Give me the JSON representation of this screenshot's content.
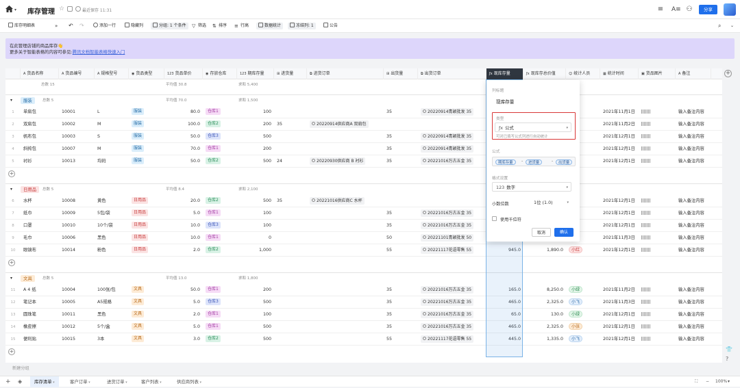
{
  "app": {
    "title": "库存管理",
    "saved": "最近保存 11:31",
    "share": "分享"
  },
  "toolbar": {
    "table_name": "库存明细表",
    "add_row": "添加一行",
    "hide_cols": "隐藏列",
    "group": "分组: 1 个条件",
    "filter": "筛选",
    "sort": "排序",
    "row_height": "行高",
    "stats": "数据统计",
    "freeze": "冻结列: 1",
    "notice": "公告"
  },
  "banner": {
    "line1": "在此管理店铺的商品库存👋",
    "line2_prefix": "更多关于智能表格的内容可参见:",
    "line2_link": "腾讯文档智能表格快速入门"
  },
  "columns": [
    {
      "label": "货品名称",
      "icon": "text-icon"
    },
    {
      "label": "货品编号",
      "icon": "text-icon"
    },
    {
      "label": "规格型号",
      "icon": "text-icon"
    },
    {
      "label": "货品类型",
      "icon": "select-icon"
    },
    {
      "label": "货品单价",
      "icon": "number-icon"
    },
    {
      "label": "存放仓库",
      "icon": "select-icon"
    },
    {
      "label": "期库存量",
      "icon": "number-icon"
    },
    {
      "label": "进货量",
      "icon": "lookup-icon"
    },
    {
      "label": "进货订单",
      "icon": "link-icon"
    },
    {
      "label": "出货量",
      "icon": "lookup-icon"
    },
    {
      "label": "出货订单",
      "icon": "link-icon"
    },
    {
      "label": "现库存量",
      "icon": "formula-icon"
    },
    {
      "label": "现库存总价值",
      "icon": "formula-icon"
    },
    {
      "label": "统计人员",
      "icon": "person-icon"
    },
    {
      "label": "统计时间",
      "icon": "date-icon"
    },
    {
      "label": "货品图片",
      "icon": "image-icon"
    },
    {
      "label": "备注",
      "icon": "text-icon"
    }
  ],
  "summary": {
    "count": "总数 15",
    "avg": "平均值 30.8",
    "sum": "求和 5,400"
  },
  "groups": [
    {
      "name": "服装",
      "tag_class": "t-fz",
      "count": "总数 5",
      "avg": "平均值 70.0",
      "sum": "求和 1,500",
      "rows": [
        {
          "n": "1",
          "name": "单肩包",
          "code": "10001",
          "spec": "L",
          "type": "服装",
          "price": "80.0",
          "wh": "仓库1",
          "whc": "w1",
          "stock": "100",
          "in": "",
          "in_order": "",
          "out": "35",
          "out_order": "20220914青颖批发 35",
          "now": "",
          "val": "",
          "person": "",
          "pc": "",
          "date": "2021年11月1日",
          "note": "输入备注内容"
        },
        {
          "n": "2",
          "name": "双肩包",
          "code": "10002",
          "spec": "M",
          "type": "服装",
          "price": "100.0",
          "wh": "仓库2",
          "whc": "w2",
          "stock": "200",
          "in": "35",
          "in_order": "20220914供应商A 双肩包",
          "out": "",
          "out_order": "",
          "now": "",
          "val": "",
          "person": "",
          "pc": "",
          "date": "2021年11月2日",
          "note": "输入备注内容"
        },
        {
          "n": "3",
          "name": "帆布包",
          "code": "10003",
          "spec": "S",
          "type": "服装",
          "price": "50.0",
          "wh": "仓库3",
          "whc": "w3",
          "stock": "500",
          "in": "",
          "in_order": "",
          "out": "35",
          "out_order": "20220914青颖批发 35",
          "now": "",
          "val": "",
          "person": "",
          "pc": "",
          "date": "2021年12月1日",
          "note": "输入备注内容"
        },
        {
          "n": "4",
          "name": "斜挎包",
          "code": "10007",
          "spec": "M",
          "type": "服装",
          "price": "70.0",
          "wh": "仓库1",
          "whc": "w1",
          "stock": "200",
          "in": "",
          "in_order": "",
          "out": "35",
          "out_order": "20220914青颖批发 35",
          "now": "",
          "val": "",
          "person": "",
          "pc": "",
          "date": "2021年12月1日",
          "note": "输入备注内容"
        },
        {
          "n": "5",
          "name": "衬衫",
          "code": "10013",
          "spec": "均码",
          "type": "服装",
          "price": "50.0",
          "wh": "仓库2",
          "whc": "w2",
          "stock": "500",
          "in": "24",
          "in_order": "20220930供应商 B 衬衫",
          "out": "35",
          "out_order": "20221016万古五金 35",
          "now": "",
          "val": "",
          "person": "",
          "pc": "",
          "date": "2021年12月1日",
          "note": "输入备注内容"
        }
      ]
    },
    {
      "name": "日用品",
      "tag_class": "t-ry",
      "count": "总数 5",
      "avg": "平均值 8.4",
      "sum": "求和 2,100",
      "rows": [
        {
          "n": "6",
          "name": "水杯",
          "code": "10008",
          "spec": "黄色",
          "type": "日用品",
          "price": "20.0",
          "wh": "仓库2",
          "whc": "w2",
          "stock": "500",
          "in": "35",
          "in_order": "20221016供应商C 水杯",
          "out": "",
          "out_order": "",
          "now": "",
          "val": "",
          "person": "",
          "pc": "",
          "date": "2021年12月1日",
          "note": "输入备注内容"
        },
        {
          "n": "7",
          "name": "纸巾",
          "code": "10009",
          "spec": "5包/袋",
          "type": "日用品",
          "price": "5.0",
          "wh": "仓库1",
          "whc": "w1",
          "stock": "100",
          "in": "",
          "in_order": "",
          "out": "35",
          "out_order": "20221016万古五金 35",
          "now": "",
          "val": "",
          "person": "",
          "pc": "",
          "date": "2021年12月1日",
          "note": "输入备注内容"
        },
        {
          "n": "8",
          "name": "口罩",
          "code": "10010",
          "spec": "10个/袋",
          "type": "日用品",
          "price": "10.0",
          "wh": "仓库3",
          "whc": "w3",
          "stock": "100",
          "in": "",
          "in_order": "",
          "out": "35",
          "out_order": "20221016万古五金 35",
          "now": "",
          "val": "",
          "person": "",
          "pc": "",
          "date": "2021年12月1日",
          "note": "输入备注内容"
        },
        {
          "n": "9",
          "name": "毛巾",
          "code": "10006",
          "spec": "黑色",
          "type": "日用品",
          "price": "10.0",
          "wh": "仓库1",
          "whc": "w1",
          "stock": "0",
          "in": "",
          "in_order": "",
          "out": "50",
          "out_order": "20221101青颖批发 50",
          "now": "",
          "val": "",
          "person": "",
          "pc": "",
          "date": "2021年11月3日",
          "note": "输入备注内容"
        },
        {
          "n": "10",
          "name": "眼镜布",
          "code": "10014",
          "spec": "粉色",
          "type": "日用品",
          "price": "2.0",
          "wh": "仓库2",
          "whc": "w2",
          "stock": "1,000",
          "in": "",
          "in_order": "",
          "out": "55",
          "out_order": "20221117花语零售 55",
          "now": "945.0",
          "val": "1,890.0",
          "person": "小红",
          "pc": "p-r",
          "date": "2021年12月1日",
          "note": "输入备注内容"
        }
      ]
    },
    {
      "name": "文具",
      "tag_class": "t-wj",
      "count": "总数 5",
      "avg": "平均值 13.0",
      "sum": "求和 1,800",
      "rows": [
        {
          "n": "11",
          "name": "A 4 纸",
          "code": "10004",
          "spec": "100张/包",
          "type": "文具",
          "price": "50.0",
          "wh": "仓库1",
          "whc": "w1",
          "stock": "200",
          "in": "",
          "in_order": "",
          "out": "35",
          "out_order": "20221016万古五金 35",
          "now": "165.0",
          "val": "8,250.0",
          "person": "小绿",
          "pc": "p-g",
          "date": "2021年11月2日",
          "note": "输入备注内容"
        },
        {
          "n": "12",
          "name": "笔记本",
          "code": "10005",
          "spec": "A5规格",
          "type": "文具",
          "price": "5.0",
          "wh": "仓库3",
          "whc": "w3",
          "stock": "500",
          "in": "",
          "in_order": "",
          "out": "35",
          "out_order": "20221016万古五金 35",
          "now": "465.0",
          "val": "2,325.0",
          "person": "小飞",
          "pc": "p-b",
          "date": "2021年11月3日",
          "note": "输入备注内容"
        },
        {
          "n": "13",
          "name": "圆珠笔",
          "code": "10011",
          "spec": "黑色",
          "type": "文具",
          "price": "2.0",
          "wh": "仓库1",
          "whc": "w1",
          "stock": "100",
          "in": "",
          "in_order": "",
          "out": "35",
          "out_order": "20221016万古五金 35",
          "now": "65.0",
          "val": "130.0",
          "person": "小绿",
          "pc": "p-g",
          "date": "2021年12月1日",
          "note": "输入备注内容"
        },
        {
          "n": "14",
          "name": "橡皮擦",
          "code": "10012",
          "spec": "5个/盒",
          "type": "文具",
          "price": "5.0",
          "wh": "仓库1",
          "whc": "w1",
          "stock": "500",
          "in": "",
          "in_order": "",
          "out": "35",
          "out_order": "20221016万古五金 35",
          "now": "465.0",
          "val": "2,325.0",
          "person": "小张",
          "pc": "p-o",
          "date": "2021年12月1日",
          "note": "输入备注内容"
        },
        {
          "n": "15",
          "name": "便利贴",
          "code": "10015",
          "spec": "3本",
          "type": "文具",
          "price": "3.0",
          "wh": "仓库2",
          "whc": "w2",
          "stock": "500",
          "in": "",
          "in_order": "",
          "out": "55",
          "out_order": "20221117花语零售 55",
          "now": "445.0",
          "val": "1,335.0",
          "person": "小飞",
          "pc": "p-b",
          "date": "2021年12月1日",
          "note": "输入备注内容"
        }
      ]
    }
  ],
  "new_group": "新建分组",
  "sheets": [
    "库存清单",
    "客户订单",
    "进货订单",
    "客户列表",
    "供应商列表"
  ],
  "zoom": "100%",
  "popup": {
    "col_name_label": "列标题",
    "col_name": "现库存量",
    "type_label": "类型",
    "type_value": "公式",
    "type_note": "可对已填写公式列进行自动统计",
    "formula_label": "公式",
    "formula": [
      "期库存量",
      "-",
      "进货量",
      "-",
      "出货量"
    ],
    "format_label": "格式设置",
    "format_value": "数字",
    "decimal_label": "小数位数",
    "decimal_value": "1位 (1.0)",
    "thousands": "使用千位符",
    "cancel": "取消",
    "ok": "确认"
  }
}
